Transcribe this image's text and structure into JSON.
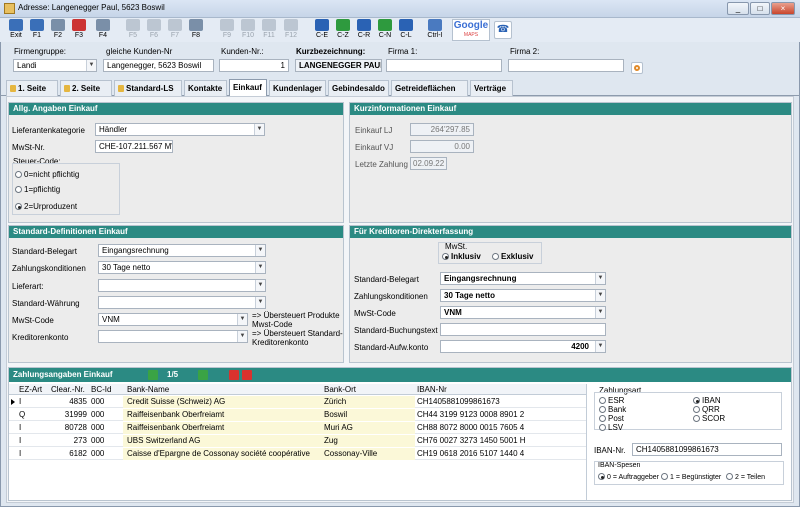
{
  "window": {
    "title": "Adresse: Langenegger Paul, 5623 Boswil",
    "controls": [
      "_",
      "□",
      "×"
    ]
  },
  "toolbar": [
    {
      "label": "Exit",
      "color": "#3a6fb8",
      "enabled": true
    },
    {
      "label": "F1",
      "color": "#3a6fb8",
      "enabled": true
    },
    {
      "label": "F2",
      "color": "#7a8fa8",
      "enabled": true
    },
    {
      "label": "F3",
      "color": "#c33",
      "enabled": true
    },
    {
      "label": "F4",
      "color": "#7a8fa8",
      "enabled": true
    },
    {
      "label": "F5",
      "color": "#bcc6d2",
      "enabled": false
    },
    {
      "label": "F6",
      "color": "#bcc6d2",
      "enabled": false
    },
    {
      "label": "F7",
      "color": "#bcc6d2",
      "enabled": false
    },
    {
      "label": "F8",
      "color": "#7a8fa8",
      "enabled": true
    },
    {
      "label": "F9",
      "color": "#bcc6d2",
      "enabled": false
    },
    {
      "label": "F10",
      "color": "#bcc6d2",
      "enabled": false
    },
    {
      "label": "F11",
      "color": "#bcc6d2",
      "enabled": false
    },
    {
      "label": "F12",
      "color": "#bcc6d2",
      "enabled": false
    },
    {
      "label": "C-E",
      "color": "#2a62b4",
      "enabled": true
    },
    {
      "label": "C-Z",
      "color": "#2e9a3e",
      "enabled": true
    },
    {
      "label": "C-R",
      "color": "#2a62b4",
      "enabled": true
    },
    {
      "label": "C-N",
      "color": "#2e9a3e",
      "enabled": true
    },
    {
      "label": "C-L",
      "color": "#2a62b4",
      "enabled": true
    },
    {
      "label": "Ctrl-I",
      "color": "#4a7ac0",
      "enabled": true
    }
  ],
  "google": {
    "label": "Google",
    "sub": "MAPS"
  },
  "header": {
    "firmengruppe_label": "Firmengruppe:",
    "firmengruppe_value": "Landi",
    "gleiche_label": "gleiche Kunden-Nr",
    "gleiche_value": "Langenegger, 5623 Boswil",
    "kundennr_label": "Kunden-Nr.:",
    "kundennr_value": "1",
    "kurz_label": "Kurzbezeichnung:",
    "kurz_value": "LANGENEGGER PAUL",
    "firma1_label": "Firma 1:",
    "firma1_value": "",
    "firma2_label": "Firma 2:",
    "firma2_value": ""
  },
  "tabs": [
    {
      "label": "1. Seite",
      "lock": true
    },
    {
      "label": "2. Seite",
      "lock": true
    },
    {
      "label": "Standard-LS",
      "lock": true
    },
    {
      "label": "Kontakte",
      "lock": false
    },
    {
      "label": "Einkauf",
      "lock": false,
      "active": true
    },
    {
      "label": "Kundenlager",
      "lock": false
    },
    {
      "label": "Gebindesaldo",
      "lock": false
    },
    {
      "label": "Getreideflächen",
      "lock": false
    },
    {
      "label": "Verträge",
      "lock": false
    }
  ],
  "allg": {
    "title": "Allg. Angaben Einkauf",
    "lieferantenkategorie_label": "Lieferantenkategorie",
    "lieferantenkategorie_value": "Händler",
    "mwst_label": "MwSt-Nr.",
    "mwst_value": "CHE-107.211.567 MWST",
    "steuer_label": "Steuer-Code:",
    "steuer_options": [
      "0=nicht pflichtig",
      "1=pflichtig",
      "2=Urproduzent"
    ],
    "steuer_selected": 2
  },
  "kurzinfo": {
    "title": "Kurzinformationen Einkauf",
    "lj_label": "Einkauf LJ",
    "lj_value": "264'297.85",
    "vj_label": "Einkauf VJ",
    "vj_value": "0.00",
    "zahlung_label": "Letzte Zahlung",
    "zahlung_value": "02.09.22"
  },
  "stddef": {
    "title": "Standard-Definitionen Einkauf",
    "belegart_label": "Standard-Belegart",
    "belegart_value": "Eingangsrechnung",
    "zahlung_label": "Zahlungskonditionen",
    "zahlung_value": "30 Tage netto",
    "lieferart_label": "Lieferart:",
    "lieferart_value": "",
    "waehrung_label": "Standard-Währung",
    "waehrung_value": "",
    "mwstcode_label": "MwSt-Code",
    "mwstcode_value": "VNM",
    "mwstcode_note": "=> Übersteuert Produkte Mwst-Code",
    "kreditorenkonto_label": "Kreditorenkonto",
    "kreditorenkonto_value": "",
    "kreditorenkonto_note": "=> Übersteuert Standard-Kreditorenkonto"
  },
  "kreditoren": {
    "title": "Für Kreditoren-Direkterfassung",
    "mwst_label": "MwSt.",
    "inklusiv": "Inklusiv",
    "exklusiv": "Exklusiv",
    "belegart_label": "Standard-Belegart",
    "belegart_value": "Eingangsrechnung",
    "zahlung_label": "Zahlungskonditionen",
    "zahlung_value": "30 Tage netto",
    "mwstcode_label": "MwSt-Code",
    "mwstcode_value": "VNM",
    "buchungstext_label": "Standard-Buchungstext",
    "buchungstext_value": "",
    "aufwkonto_label": "Standard-Aufw.konto",
    "aufwkonto_value": "4200"
  },
  "zahlung": {
    "title": "Zahlungsangaben Einkauf",
    "pager": "1/5",
    "columns": [
      "EZ-Art",
      "Clear.-Nr.",
      "BC-Id",
      "Bank-Name",
      "Bank-Ort",
      "IBAN-Nr"
    ],
    "rows": [
      {
        "ez": "I",
        "clear": "4835",
        "bc": "000",
        "name": "Credit Suisse (Schweiz) AG",
        "ort": "Zürich",
        "iban": "CH1405881099861673",
        "current": true
      },
      {
        "ez": "Q",
        "clear": "31999",
        "bc": "000",
        "name": "Raiffeisenbank Oberfreiamt",
        "ort": "Boswil",
        "iban": "CH44 3199 9123 0008 8901 2",
        "current": false
      },
      {
        "ez": "I",
        "clear": "80728",
        "bc": "000",
        "name": "Raiffeisenbank Oberfreiamt",
        "ort": "Muri AG",
        "iban": "CH88 8072 8000 0015 7605 4",
        "current": false
      },
      {
        "ez": "I",
        "clear": "273",
        "bc": "000",
        "name": "UBS Switzerland AG",
        "ort": "Zug",
        "iban": "CH76 0027 3273 1450 5001 H",
        "current": false
      },
      {
        "ez": "I",
        "clear": "6182",
        "bc": "000",
        "name": "Caisse d'Epargne de Cossonay société coopérative",
        "ort": "Cossonay-Ville",
        "iban": "CH19 0618 2016 5107 1440 4",
        "current": false
      }
    ],
    "zahlungsart_label": "Zahlungsart",
    "zahlungsart": [
      "ESR",
      "IBAN",
      "Bank",
      "QRR",
      "Post",
      "SCOR",
      "LSV"
    ],
    "zahlungsart_selected": "IBAN",
    "ibannr_label": "IBAN-Nr.",
    "ibannr_value": "CH1405881099861673",
    "spesen_label": "IBAN-Spesen",
    "spesen": [
      "0 = Auftraggeber",
      "1 = Begünstigter",
      "2 = Teilen"
    ],
    "spesen_selected": 0
  }
}
